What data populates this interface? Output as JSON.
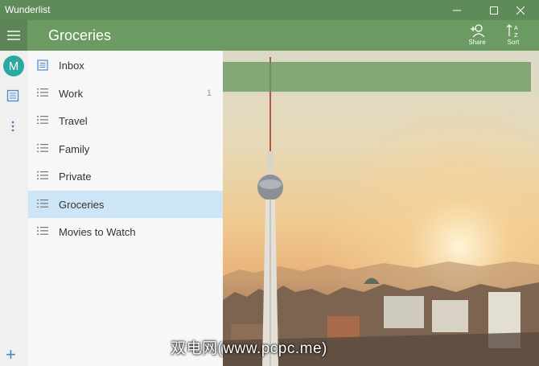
{
  "window": {
    "title": "Wunderlist"
  },
  "header": {
    "list_title": "Groceries",
    "share_label": "Share",
    "sort_label": "Sort"
  },
  "strip": {
    "avatar_initial": "M"
  },
  "sidebar": {
    "items": [
      {
        "label": "Inbox",
        "icon": "inbox-icon",
        "count": ""
      },
      {
        "label": "Work",
        "icon": "list-icon",
        "count": "1"
      },
      {
        "label": "Travel",
        "icon": "list-icon",
        "count": ""
      },
      {
        "label": "Family",
        "icon": "list-icon",
        "count": ""
      },
      {
        "label": "Private",
        "icon": "list-icon",
        "count": ""
      },
      {
        "label": "Groceries",
        "icon": "list-icon",
        "count": "",
        "selected": true
      },
      {
        "label": "Movies to Watch",
        "icon": "list-icon",
        "count": ""
      }
    ]
  },
  "watermark": "双电网(www.pcpc.me)",
  "colors": {
    "header": "#6b9a63",
    "titlebar": "#5f8a5a",
    "selected": "#cde6f7",
    "avatar": "#2aa9a0",
    "accent": "#4a86c8"
  }
}
